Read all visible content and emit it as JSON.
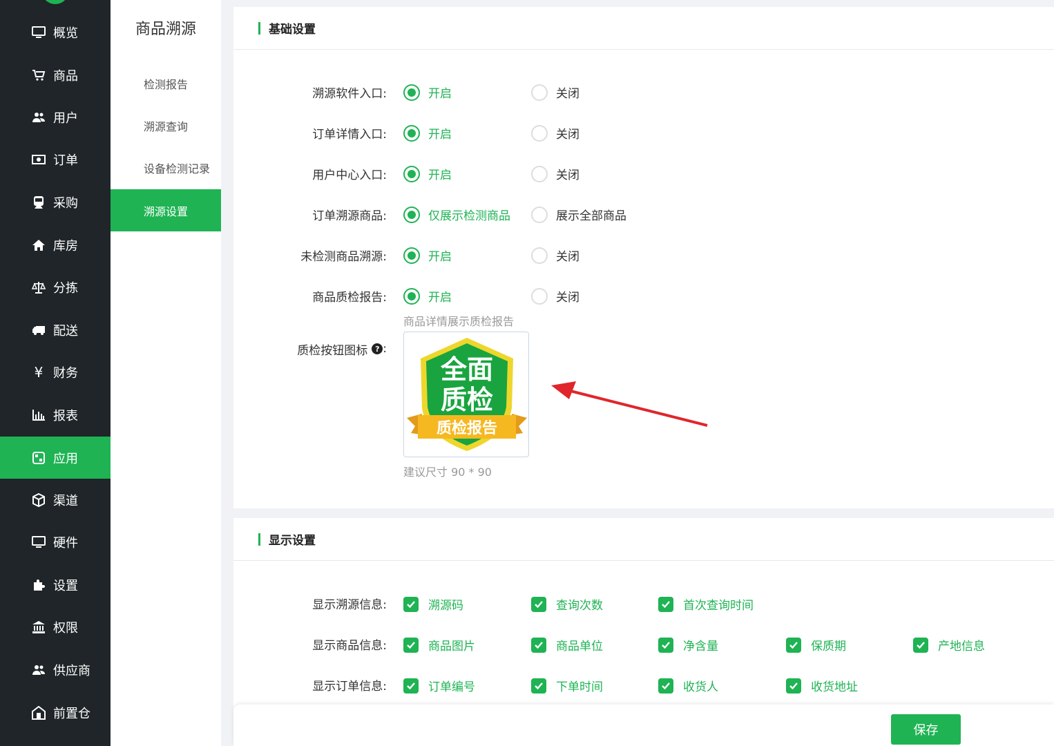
{
  "nav": {
    "items": [
      {
        "label": "概览",
        "icon": "monitor-icon"
      },
      {
        "label": "商品",
        "icon": "cart-icon"
      },
      {
        "label": "用户",
        "icon": "users-icon"
      },
      {
        "label": "订单",
        "icon": "money-icon"
      },
      {
        "label": "采购",
        "icon": "train-icon"
      },
      {
        "label": "库房",
        "icon": "home-icon"
      },
      {
        "label": "分拣",
        "icon": "balance-icon"
      },
      {
        "label": "配送",
        "icon": "truck-icon"
      },
      {
        "label": "财务",
        "icon": "yen-icon"
      },
      {
        "label": "报表",
        "icon": "bar-chart-icon"
      },
      {
        "label": "应用",
        "icon": "app-icon"
      },
      {
        "label": "渠道",
        "icon": "cube-icon"
      },
      {
        "label": "硬件",
        "icon": "monitor-icon"
      },
      {
        "label": "设置",
        "icon": "puzzle-icon"
      },
      {
        "label": "权限",
        "icon": "bank-icon"
      },
      {
        "label": "供应商",
        "icon": "users-icon"
      },
      {
        "label": "前置仓",
        "icon": "warehouse-icon"
      }
    ],
    "active_color": "#1fb354"
  },
  "subnav": {
    "title": "商品溯源",
    "items": [
      "检测报告",
      "溯源查询",
      "设备检测记录",
      "溯源设置"
    ]
  },
  "basic": {
    "title": "基础设置",
    "rows": [
      {
        "label": "溯源软件入口:",
        "on": "开启",
        "off": "关闭"
      },
      {
        "label": "订单详情入口:",
        "on": "开启",
        "off": "关闭"
      },
      {
        "label": "用户中心入口:",
        "on": "开启",
        "off": "关闭"
      },
      {
        "label": "订单溯源商品:",
        "on": "仅展示检测商品",
        "off": "展示全部商品"
      },
      {
        "label": "未检测商品溯源:",
        "on": "开启",
        "off": "关闭"
      },
      {
        "label": "商品质检报告:",
        "on": "开启",
        "off": "关闭"
      }
    ],
    "report_hint": "商品详情展示质检报告",
    "icon_label": "质检按钮图标",
    "icon_colon": ":",
    "badge_line1": "全面",
    "badge_line2": "质检",
    "badge_ribbon": "质检报告",
    "size_hint": "建议尺寸 90 * 90"
  },
  "display": {
    "title": "显示设置",
    "rows": [
      {
        "label": "显示溯源信息:",
        "options": [
          "溯源码",
          "查询次数",
          "首次查询时间"
        ]
      },
      {
        "label": "显示商品信息:",
        "options": [
          "商品图片",
          "商品单位",
          "净含量",
          "保质期",
          "产地信息"
        ]
      },
      {
        "label": "显示订单信息:",
        "options": [
          "订单编号",
          "下单时间",
          "收货人",
          "收货地址"
        ]
      }
    ]
  },
  "footer": {
    "save_label": "保存"
  },
  "colors": {
    "accent": "#1fb354",
    "arrow": "#e0262b",
    "nav_bg": "#1f2528"
  }
}
